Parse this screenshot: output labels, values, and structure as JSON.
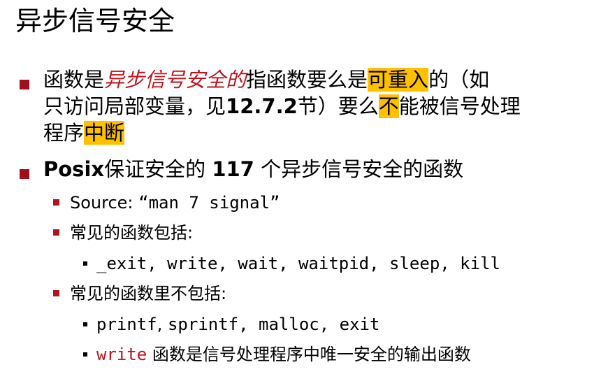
{
  "title": "异步信号安全",
  "bullet1": {
    "prefix": "函数是",
    "term": "异步信号安全的",
    "text1": "指函数要么是",
    "hl1": "可重入",
    "text2": "的（如",
    "line2_a": "只访问局部变量，见",
    "line2_ref": "12.7.2",
    "line2_b": "节）要么",
    "hl2": "不",
    "line2_c": "能被信号处理",
    "line3_a": "程序",
    "hl3": "中断"
  },
  "bullet2": {
    "posix": "Posix",
    "text1": "保证安全的 ",
    "count": "117",
    "text2": " 个异步信号安全的函数"
  },
  "sub1": {
    "label": "Source: ",
    "value": "“man 7 signal”"
  },
  "sub2": {
    "label": "常见的函数包括:"
  },
  "sub2_item": "_exit, write, wait, waitpid, sleep, kill",
  "sub3": {
    "label": "常见的函数里不包括:"
  },
  "sub3_item1": {
    "a": "printf",
    "sep1": ", ",
    "b": "sprintf",
    "rest": ", malloc, exit"
  },
  "sub3_item2": {
    "fn": "write",
    "text": " 函数是信号处理程序中唯一安全的输出函数"
  },
  "colors": {
    "bullet": "#a10f1b",
    "accent": "#c0141c",
    "highlight": "#ffc000"
  }
}
